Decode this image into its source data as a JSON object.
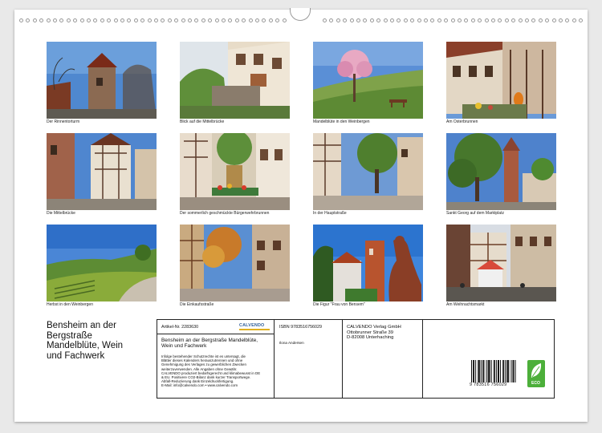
{
  "photos": [
    {
      "caption": "Der Rinnentorturm"
    },
    {
      "caption": "Blick auf die Mittelbrücke"
    },
    {
      "caption": "Mandelblüte in den Weinbergen"
    },
    {
      "caption": "Am Osterbrunnen"
    },
    {
      "caption": "Die Mittelbrücke"
    },
    {
      "caption": "Der sommerlich geschmückte Bürgerwehrbrunnen"
    },
    {
      "caption": "In der Hauptstraße"
    },
    {
      "caption": "Sankt Georg auf dem Marktplatz"
    },
    {
      "caption": "Herbst in den Weinbergen"
    },
    {
      "caption": "Die Einkaufsstraße"
    },
    {
      "caption": "Die Figur \"Frau von Bensem\""
    },
    {
      "caption": "Am Weihnachtsmarkt"
    }
  ],
  "calendar": {
    "title_line1": "Bensheim an der",
    "title_line2": "Bergstraße",
    "title_line3": "Mandelblüte, Wein",
    "title_line4": "und Fachwerk"
  },
  "info": {
    "article_label": "Artikel-Nr. 2283630",
    "publisher_logo": "CALVENDO",
    "subtitle_line1": "Bensheim an der Bergstraße Mandelblüte,",
    "subtitle_line2": "Wein und Fachwerk",
    "legal_text": [
      "Infolge bestehender Schutzrechte ist es untersagt, die",
      "Blätter dieses Kalenders herauszutrennen und ohne",
      "Genehmigung des Verlages zu gewerblichen Zwecken",
      "weiterzuverwenden. Alle Angaben ohne Gewähr.",
      "CALVENDO produziert bedarfsgerecht und klimabewusst in DE",
      "& EU. Positivere CO2-Bilanz dank kurzer Transportwege.",
      "Abfall-Reduzierung dank Einzeldruckfertigung.",
      "E-Mail: info@calvendo.com • www.calvendo.com"
    ],
    "isbn": "ISBN 9783516756029",
    "author": "Ilona Andersen",
    "publisher_line1": "CALVENDO Verlag GmbH",
    "publisher_line2": "Ottobrunner Straße 39",
    "publisher_line3": "D-82008 Unterhaching",
    "barcode_digits": "9  783516  756029",
    "eco_label": "ECO"
  }
}
